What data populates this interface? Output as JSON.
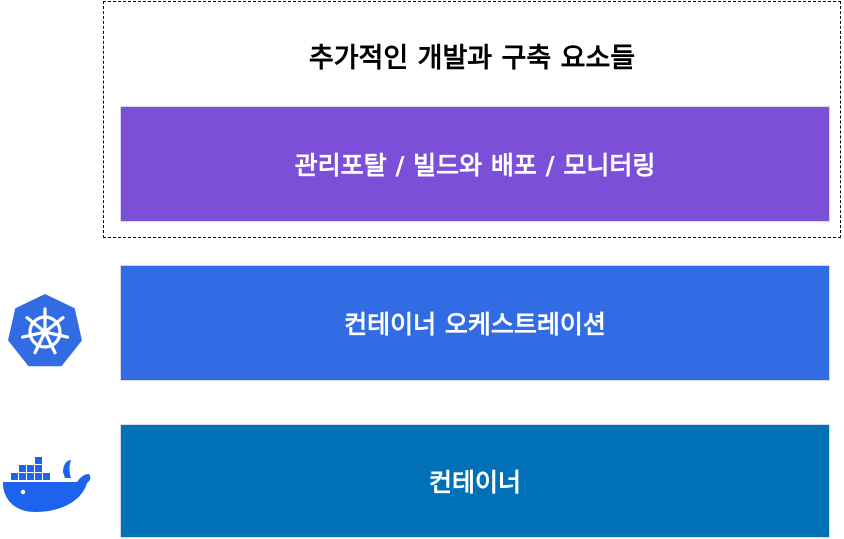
{
  "group": {
    "title": "추가적인 개발과 구축 요소들"
  },
  "layers": [
    {
      "label": "관리포탈 / 빌드와 배포 / 모니터링",
      "color": "#7B4FD8"
    },
    {
      "label": "컨테이너 오케스트레이션",
      "color": "#316CE4",
      "icon": "kubernetes-icon"
    },
    {
      "label": "컨테이너",
      "color": "#0071B7",
      "icon": "docker-icon"
    }
  ],
  "icon_colors": {
    "kubernetes": "#326CE5",
    "docker": "#1D63ED"
  }
}
